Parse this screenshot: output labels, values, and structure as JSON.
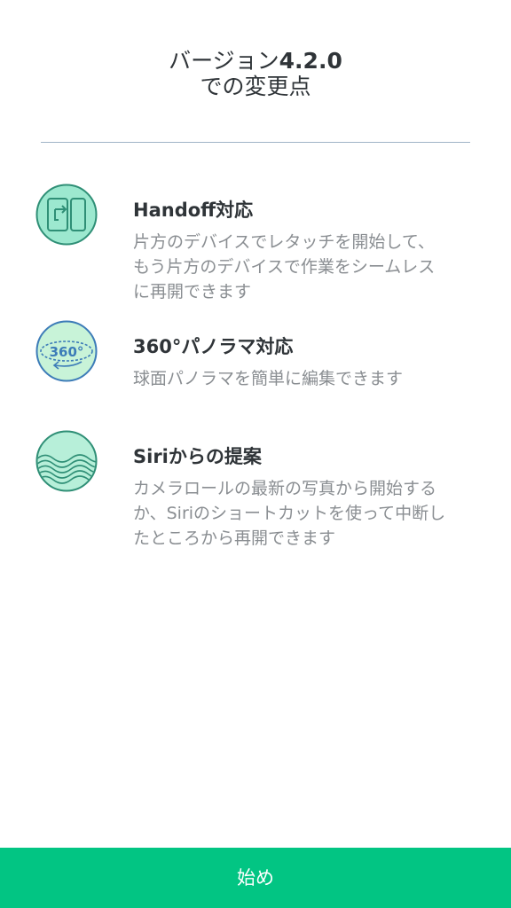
{
  "header": {
    "title_line1_prefix": "バージョン",
    "title_line1_version": "4.2.0",
    "title_line2": "での変更点"
  },
  "features": [
    {
      "icon": "handoff-devices-icon",
      "title": "Handoff対応",
      "lines": [
        "片方のデバイスでレタッチを開始して、",
        "もう片方のデバイスで作業をシームレス",
        "に再開できます"
      ]
    },
    {
      "icon": "panorama-360-icon",
      "title": "360°パノラマ対応",
      "icon_text": "360°",
      "lines": [
        "球面パノラマを簡単に編集できます"
      ]
    },
    {
      "icon": "siri-waves-icon",
      "title": "Siriからの提案",
      "lines": [
        "カメラロールの最新の写真から開始する",
        "か、Siriのショートカットを使って中断し",
        "たところから再開できます"
      ]
    }
  ],
  "footer": {
    "start_label": "始め"
  },
  "colors": {
    "accent": "#02c583",
    "divider": "#9fb3c6",
    "icon_fill": "#9ce8cf",
    "icon_stroke": "#2f8f76",
    "panorama_fill": "#c8f3d8",
    "panorama_stroke": "#3d7cb8"
  }
}
